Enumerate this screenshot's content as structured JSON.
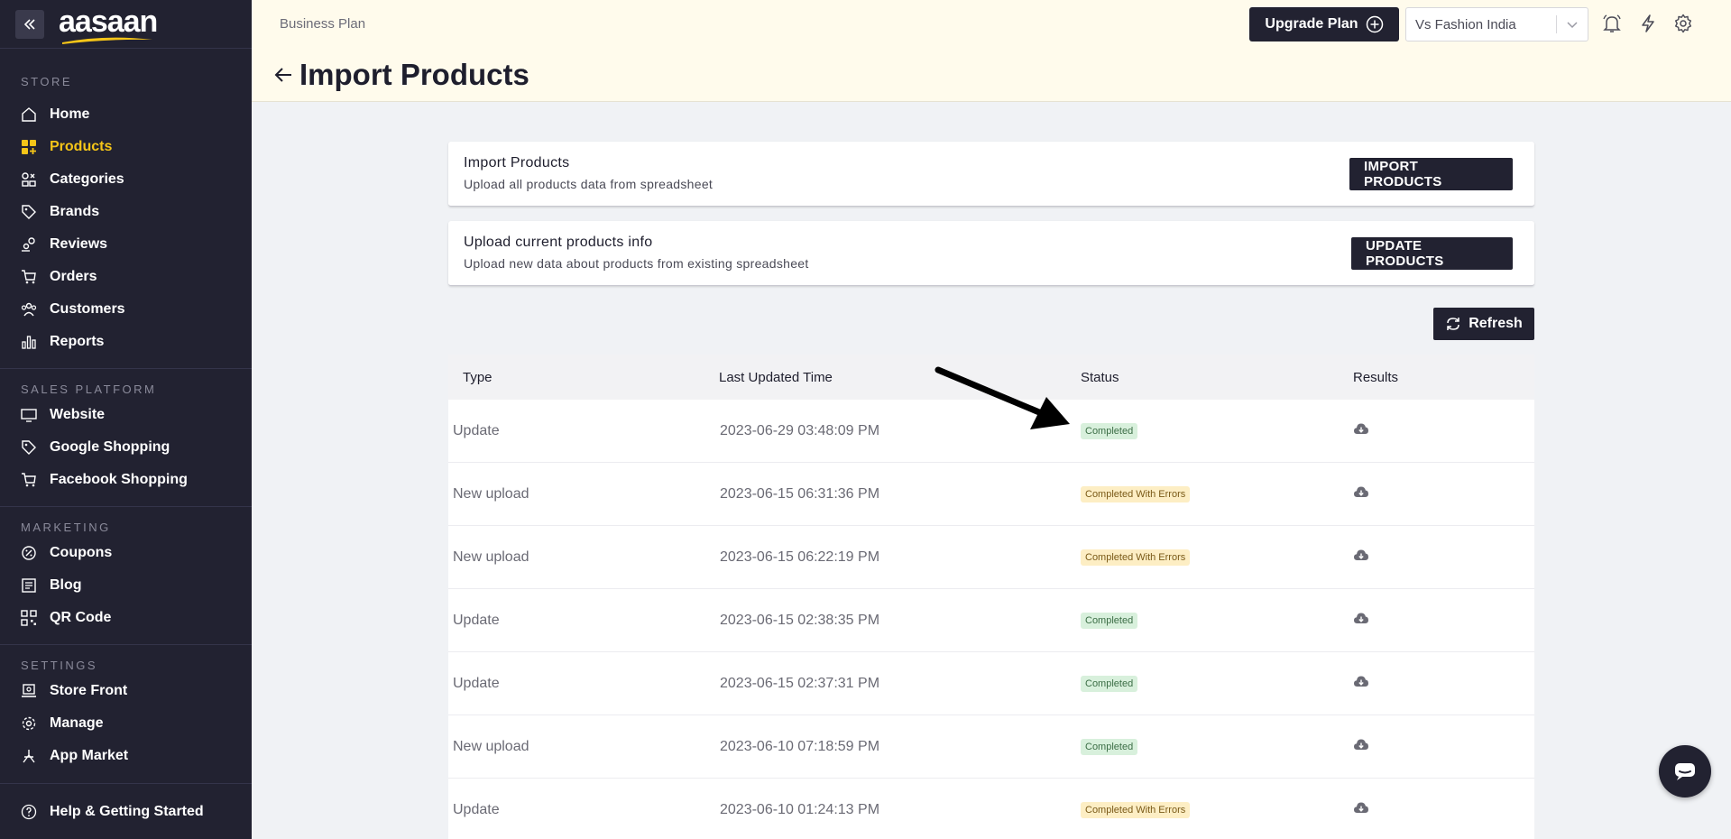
{
  "brand": {
    "name": "aasaan",
    "accent": "#f5c518",
    "sidebar_bg": "#222231"
  },
  "sidebar": {
    "sections": [
      {
        "title": "STORE",
        "items": [
          {
            "label": "Home",
            "icon": "home-icon",
            "active": false
          },
          {
            "label": "Products",
            "icon": "products-icon",
            "active": true
          },
          {
            "label": "Categories",
            "icon": "categories-icon",
            "active": false
          },
          {
            "label": "Brands",
            "icon": "tag-icon",
            "active": false
          },
          {
            "label": "Reviews",
            "icon": "reviews-icon",
            "active": false
          },
          {
            "label": "Orders",
            "icon": "cart-icon",
            "active": false
          },
          {
            "label": "Customers",
            "icon": "customers-icon",
            "active": false
          },
          {
            "label": "Reports",
            "icon": "bar-chart-icon",
            "active": false
          }
        ]
      },
      {
        "title": "SALES PLATFORM",
        "items": [
          {
            "label": "Website",
            "icon": "monitor-icon",
            "active": false
          },
          {
            "label": "Google Shopping",
            "icon": "tag-icon",
            "active": false
          },
          {
            "label": "Facebook Shopping",
            "icon": "cart-icon",
            "active": false
          }
        ]
      },
      {
        "title": "MARKETING",
        "items": [
          {
            "label": "Coupons",
            "icon": "coupon-icon",
            "active": false
          },
          {
            "label": "Blog",
            "icon": "blog-icon",
            "active": false
          },
          {
            "label": "QR Code",
            "icon": "qr-code-icon",
            "active": false
          }
        ]
      },
      {
        "title": "SETTINGS",
        "items": [
          {
            "label": "Store Front",
            "icon": "store-front-icon",
            "active": false
          },
          {
            "label": "Manage",
            "icon": "gear-icon",
            "active": false
          },
          {
            "label": "App Market",
            "icon": "app-market-icon",
            "active": false
          }
        ]
      }
    ],
    "help_label": "Help & Getting Started"
  },
  "header": {
    "plan": "Business Plan",
    "title": "Import Products",
    "upgrade_label": "Upgrade Plan",
    "store_name": "Vs Fashion India"
  },
  "cards": [
    {
      "title": "Import Products",
      "subtitle": "Upload all products data from spreadsheet",
      "button": "IMPORT PRODUCTS"
    },
    {
      "title": "Upload current products info",
      "subtitle": "Upload new data about products from existing spreadsheet",
      "button": "UPDATE PRODUCTS"
    }
  ],
  "refresh_label": "Refresh",
  "table": {
    "columns": [
      "Type",
      "Last Updated Time",
      "Status",
      "Results"
    ],
    "rows": [
      {
        "type": "Update",
        "time": "2023-06-29 03:48:09 PM",
        "status": "Completed"
      },
      {
        "type": "New upload",
        "time": "2023-06-15 06:31:36 PM",
        "status": "Completed With Errors"
      },
      {
        "type": "New upload",
        "time": "2023-06-15 06:22:19 PM",
        "status": "Completed With Errors"
      },
      {
        "type": "Update",
        "time": "2023-06-15 02:38:35 PM",
        "status": "Completed"
      },
      {
        "type": "Update",
        "time": "2023-06-15 02:37:31 PM",
        "status": "Completed"
      },
      {
        "type": "New upload",
        "time": "2023-06-10 07:18:59 PM",
        "status": "Completed"
      },
      {
        "type": "Update",
        "time": "2023-06-10 01:24:13 PM",
        "status": "Completed With Errors"
      }
    ]
  }
}
